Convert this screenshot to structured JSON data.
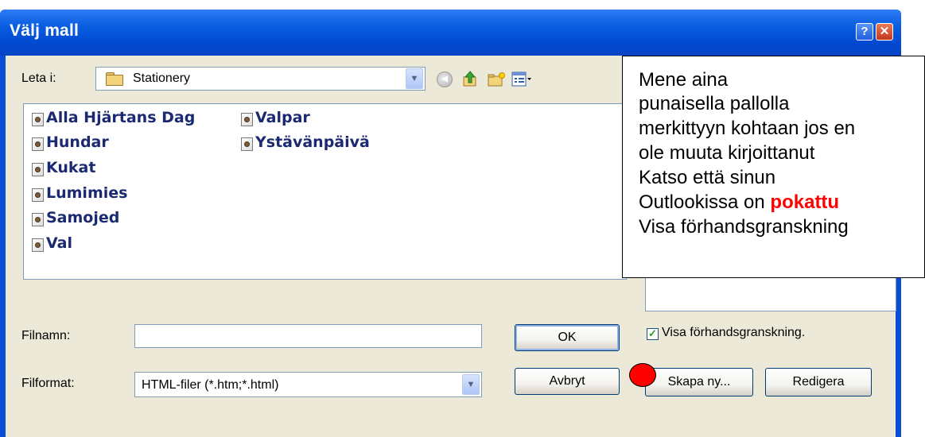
{
  "window": {
    "title": "Välj mall",
    "help_glyph": "?",
    "close_glyph": "✕"
  },
  "toolbar": {
    "look_in_label": "Leta i:",
    "look_in_value": "Stationery",
    "look_in_icon": "folder-icon",
    "icons": [
      "back-icon",
      "up-folder-icon",
      "new-folder-icon",
      "views-menu-icon"
    ]
  },
  "files": [
    {
      "name": "Alla Hjärtans Dag",
      "icon": "stationery-file-icon"
    },
    {
      "name": "Hundar",
      "icon": "stationery-file-icon"
    },
    {
      "name": "Kukat",
      "icon": "stationery-file-icon"
    },
    {
      "name": "Lumimies",
      "icon": "stationery-file-icon"
    },
    {
      "name": "Samojed",
      "icon": "stationery-file-icon"
    },
    {
      "name": "Val",
      "icon": "stationery-file-icon"
    },
    {
      "name": "Valpar",
      "icon": "stationery-file-icon"
    },
    {
      "name": "Ystävänpäivä",
      "icon": "stationery-file-icon"
    }
  ],
  "form": {
    "filename_label": "Filnamn:",
    "filename_value": "",
    "format_label": "Filformat:",
    "format_value": "HTML-filer (*.htm;*.html)"
  },
  "buttons": {
    "ok": "OK",
    "cancel": "Avbryt",
    "create_new": "Skapa ny...",
    "edit": "Redigera"
  },
  "preview": {
    "checkbox_label": "Visa förhandsgranskning.",
    "checked": true
  },
  "callout": {
    "line1": "Mene aina",
    "line2": "punaisella pallolla",
    "line3": "merkittyyn kohtaan jos en",
    "line4": "ole muuta kirjoittanut",
    "line5": "Katso että sinun",
    "line6_prefix": "Outlookissa on ",
    "line6_highlight": "pokattu",
    "line7": "Visa förhandsgranskning"
  },
  "colors": {
    "titlebar": "#0a4ed6",
    "dialog_bg": "#ece9d8",
    "file_text": "#1b2a70",
    "highlight": "#ff0000"
  }
}
